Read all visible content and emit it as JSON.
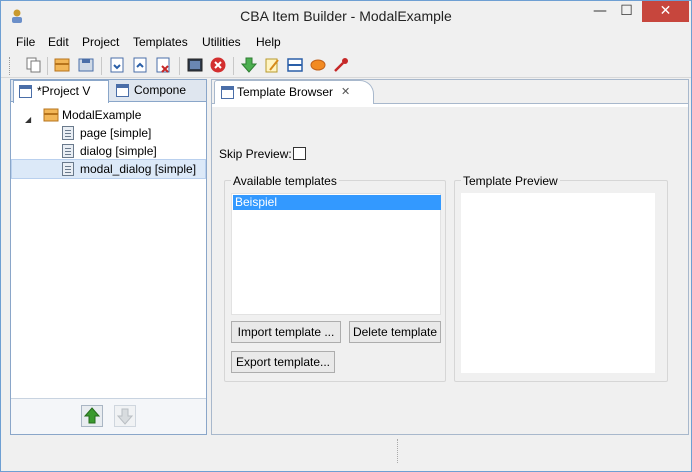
{
  "window": {
    "title": "CBA Item Builder - ModalExample",
    "controls": {
      "minimize": "—",
      "maximize": "☐",
      "close": "✕"
    }
  },
  "menu": {
    "items": [
      {
        "label": "File"
      },
      {
        "label": "Edit"
      },
      {
        "label": "Project"
      },
      {
        "label": "Templates"
      },
      {
        "label": "Utilities"
      },
      {
        "label": "Help"
      }
    ]
  },
  "toolbar": {
    "icons": [
      "copy-icon",
      "open-project-icon",
      "save-icon",
      "import-icon",
      "export-icon",
      "export-remove-icon",
      "preview-icon",
      "stop-icon",
      "down-arrow-icon",
      "edit-icon",
      "layout-icon",
      "ellipse-icon",
      "pipette-icon"
    ]
  },
  "left_panel": {
    "tabs": [
      {
        "label": "*Project V",
        "active": true
      },
      {
        "label": "Compone",
        "active": false
      }
    ],
    "tree": {
      "root": "ModalExample",
      "children": [
        {
          "label": "page [simple]"
        },
        {
          "label": "dialog [simple]"
        },
        {
          "label": "modal_dialog [simple]",
          "selected": true
        }
      ]
    }
  },
  "editor": {
    "tab": {
      "label": "Template Browser",
      "close": "✕"
    },
    "skip_preview": {
      "label": "Skip Preview:",
      "checked": false
    },
    "available_templates": {
      "title": "Available templates",
      "items": [
        {
          "label": "Beispiel",
          "selected": true
        }
      ],
      "buttons": {
        "import": "Import template ...",
        "delete": "Delete template",
        "export": "Export template..."
      }
    },
    "template_preview": {
      "title": "Template Preview"
    }
  },
  "colors": {
    "selection": "#3399ff",
    "close_button": "#c7463d",
    "up_arrow": "#3a9a2e"
  }
}
